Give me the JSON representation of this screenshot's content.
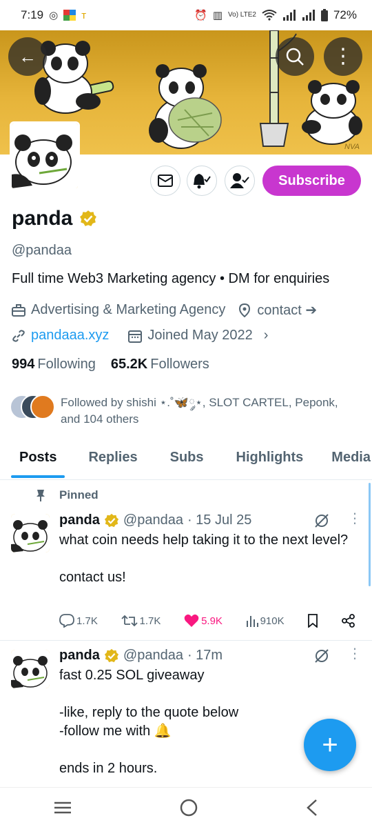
{
  "status_bar": {
    "time": "7:19",
    "battery": "72%",
    "network": "Vo) LTE2"
  },
  "profile": {
    "name": "panda",
    "handle": "@pandaa",
    "bio": "Full time Web3 Marketing agency • DM for enquiries",
    "category": "Advertising & Marketing Agency",
    "location_link": "contact ➔",
    "website": "pandaaa.xyz",
    "joined": "Joined May 2022",
    "following_count": "994",
    "following_label": "Following",
    "followers_count": "65.2K",
    "followers_label": "Followers",
    "followed_by": "Followed by shishi ⋆.˚🦋༘⋆, SLOT CARTEL, Peponk, and 104 others",
    "banner_signature": "NVA"
  },
  "actions": {
    "subscribe_label": "Subscribe"
  },
  "tabs": [
    "Posts",
    "Replies",
    "Subs",
    "Highlights",
    "Media"
  ],
  "active_tab": "Posts",
  "posts": [
    {
      "pinned_label": "Pinned",
      "name": "panda",
      "handle": "@pandaa",
      "date": "· 15 Jul 25",
      "text": "what coin needs help taking it to the next level?\n\ncontact us!",
      "replies": "1.7K",
      "reposts": "1.7K",
      "likes": "5.9K",
      "views": "910K"
    },
    {
      "name": "panda",
      "handle": "@pandaa",
      "date": "· 17m",
      "text": "fast 0.25 SOL giveaway\n\n-like, reply to the quote below\n-follow me with 🔔\n\nends in 2 hours."
    }
  ],
  "colors": {
    "accent": "#1d9bf0",
    "subscribe": "#c836cf",
    "like": "#f91880",
    "verified": "#e2b719"
  }
}
